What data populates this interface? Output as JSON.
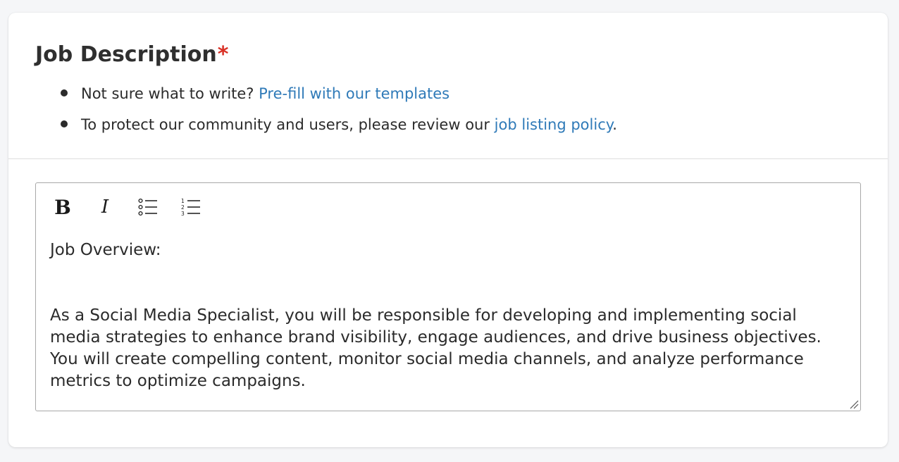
{
  "section": {
    "title": "Job Description",
    "required_marker": "*",
    "tips": [
      {
        "text": "Not sure what to write? ",
        "link": "Pre-fill with our templates",
        "suffix": ""
      },
      {
        "text": "To protect our community and users, please review our ",
        "link": "job listing policy",
        "suffix": "."
      }
    ]
  },
  "editor": {
    "toolbar": {
      "bold_label": "B",
      "italic_label": "I",
      "bullet_list_icon": "bulleted-list-icon",
      "numbered_list_icon": "numbered-list-icon"
    },
    "content": {
      "heading": "Job Overview:",
      "paragraph": "As a Social Media Specialist, you will be responsible for developing and implementing social media strategies to enhance brand visibility, engage audiences, and drive business objectives. You will create compelling content, monitor social media channels, and analyze performance metrics to optimize campaigns."
    }
  },
  "colors": {
    "link": "#2f7ab8",
    "required": "#d93025"
  }
}
